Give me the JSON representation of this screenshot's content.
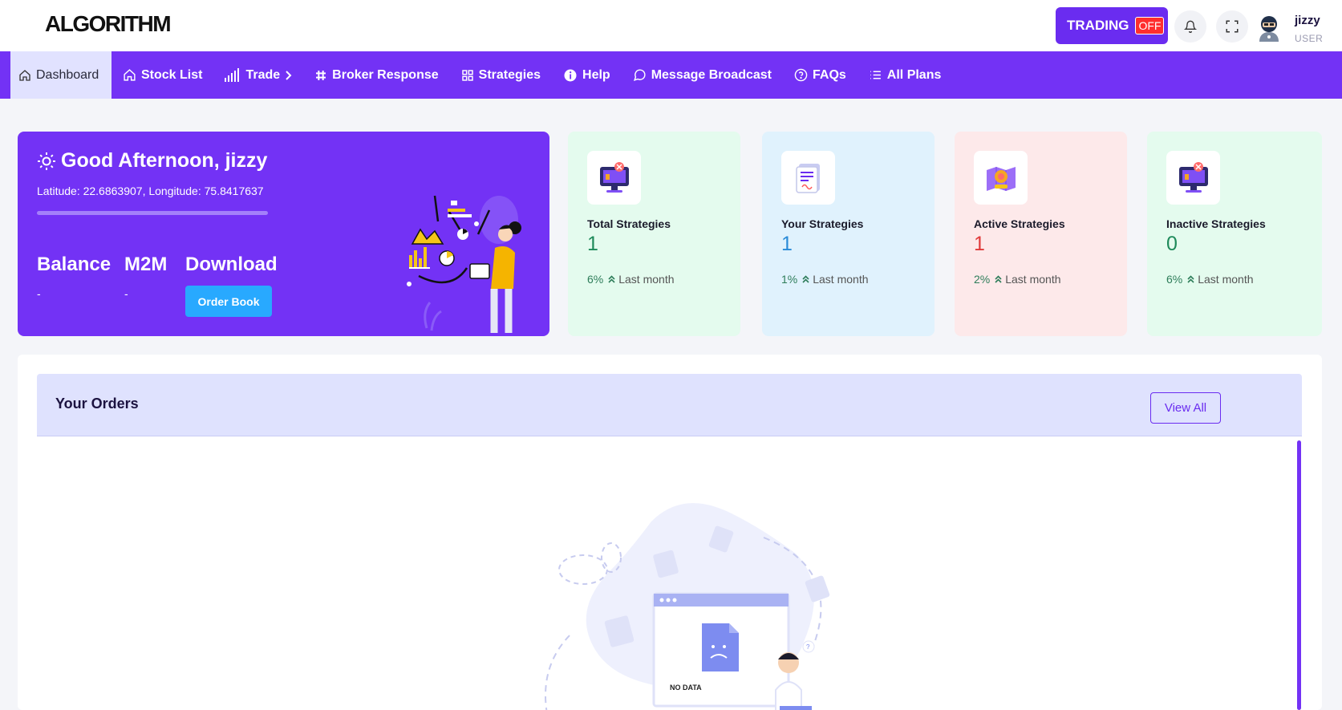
{
  "header": {
    "logo": "ALGORITHM",
    "trading_label": "TRADING",
    "trading_state": "OFF",
    "user_name": "jizzy",
    "user_role": "USER"
  },
  "nav": {
    "items": [
      {
        "label": "Dashboard",
        "icon": "home-icon",
        "active": true
      },
      {
        "label": "Stock List",
        "icon": "home-icon"
      },
      {
        "label": "Trade",
        "icon": "signal-bars-icon",
        "chevron": true
      },
      {
        "label": "Broker Response",
        "icon": "hash-icon"
      },
      {
        "label": "Strategies",
        "icon": "grid-icon"
      },
      {
        "label": "Help",
        "icon": "info-icon"
      },
      {
        "label": "Message Broadcast",
        "icon": "chat-bubble-icon"
      },
      {
        "label": "FAQs",
        "icon": "question-circle-icon"
      },
      {
        "label": "All Plans",
        "icon": "list-icon"
      }
    ]
  },
  "welcome": {
    "greeting": "Good Afternoon, jizzy",
    "coords": "Latitude: 22.6863907, Longitude: 75.8417637",
    "balance_label": "Balance",
    "balance_value": "-",
    "m2m_label": "M2M",
    "m2m_value": "-",
    "download_label": "Download",
    "order_book_button": "Order Book"
  },
  "cards": [
    {
      "title": "Total Strategies",
      "value": "1",
      "percent": "6%",
      "period": "Last month",
      "bg": "#e4fbee",
      "value_color": "#1e8a5a"
    },
    {
      "title": "Your Strategies",
      "value": "1",
      "percent": "1%",
      "period": "Last month",
      "bg": "#e0f2fd",
      "value_color": "#2a8bd8"
    },
    {
      "title": "Active Strategies",
      "value": "1",
      "percent": "2%",
      "period": "Last month",
      "bg": "#fde9ea",
      "value_color": "#e03a3a"
    },
    {
      "title": "Inactive Strategies",
      "value": "0",
      "percent": "6%",
      "period": "Last month",
      "bg": "#e4fbee",
      "value_color": "#1e8a5a"
    }
  ],
  "orders": {
    "title": "Your Orders",
    "view_all": "View All",
    "empty_label": "NO DATA"
  },
  "colors": {
    "primary": "#7332f5",
    "accent_blue": "#28a9ff",
    "trading_off": "#ff2e2e"
  }
}
